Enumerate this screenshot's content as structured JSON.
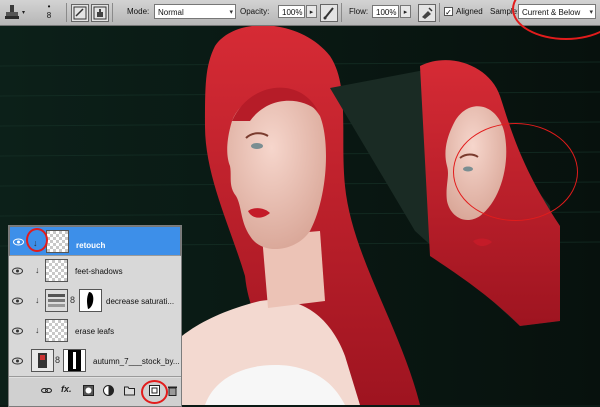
{
  "toolbar": {
    "brush_size": "8",
    "mode_label": "Mode:",
    "mode_value": "Normal",
    "opacity_label": "Opacity:",
    "opacity_value": "100%",
    "flow_label": "Flow:",
    "flow_value": "100%",
    "aligned_label": "Aligned",
    "aligned_checked": true,
    "sample_label": "Sample:",
    "sample_value": "Current & Below",
    "flyout_glyph": "▸"
  },
  "layers": [
    {
      "name": "retouch",
      "selected": true,
      "type": "pixel"
    },
    {
      "name": "feet-shadows",
      "selected": false,
      "type": "pixel"
    },
    {
      "name": "decrease saturati...",
      "selected": false,
      "type": "adjustment"
    },
    {
      "name": "erase leafs",
      "selected": false,
      "type": "pixel"
    },
    {
      "name": "autumn_7___stock_by...",
      "selected": false,
      "type": "masked-image"
    }
  ],
  "layer_panel_icons": [
    "link-layers-icon",
    "fx-icon",
    "add-mask-icon",
    "adjustment-layer-icon",
    "new-group-icon",
    "new-layer-icon",
    "delete-layer-icon"
  ],
  "colors": {
    "selected_layer": "#3d8fe9",
    "highlight_circle": "#e21c1c",
    "hair": "#c21f2b",
    "background": "#0b1a15"
  }
}
